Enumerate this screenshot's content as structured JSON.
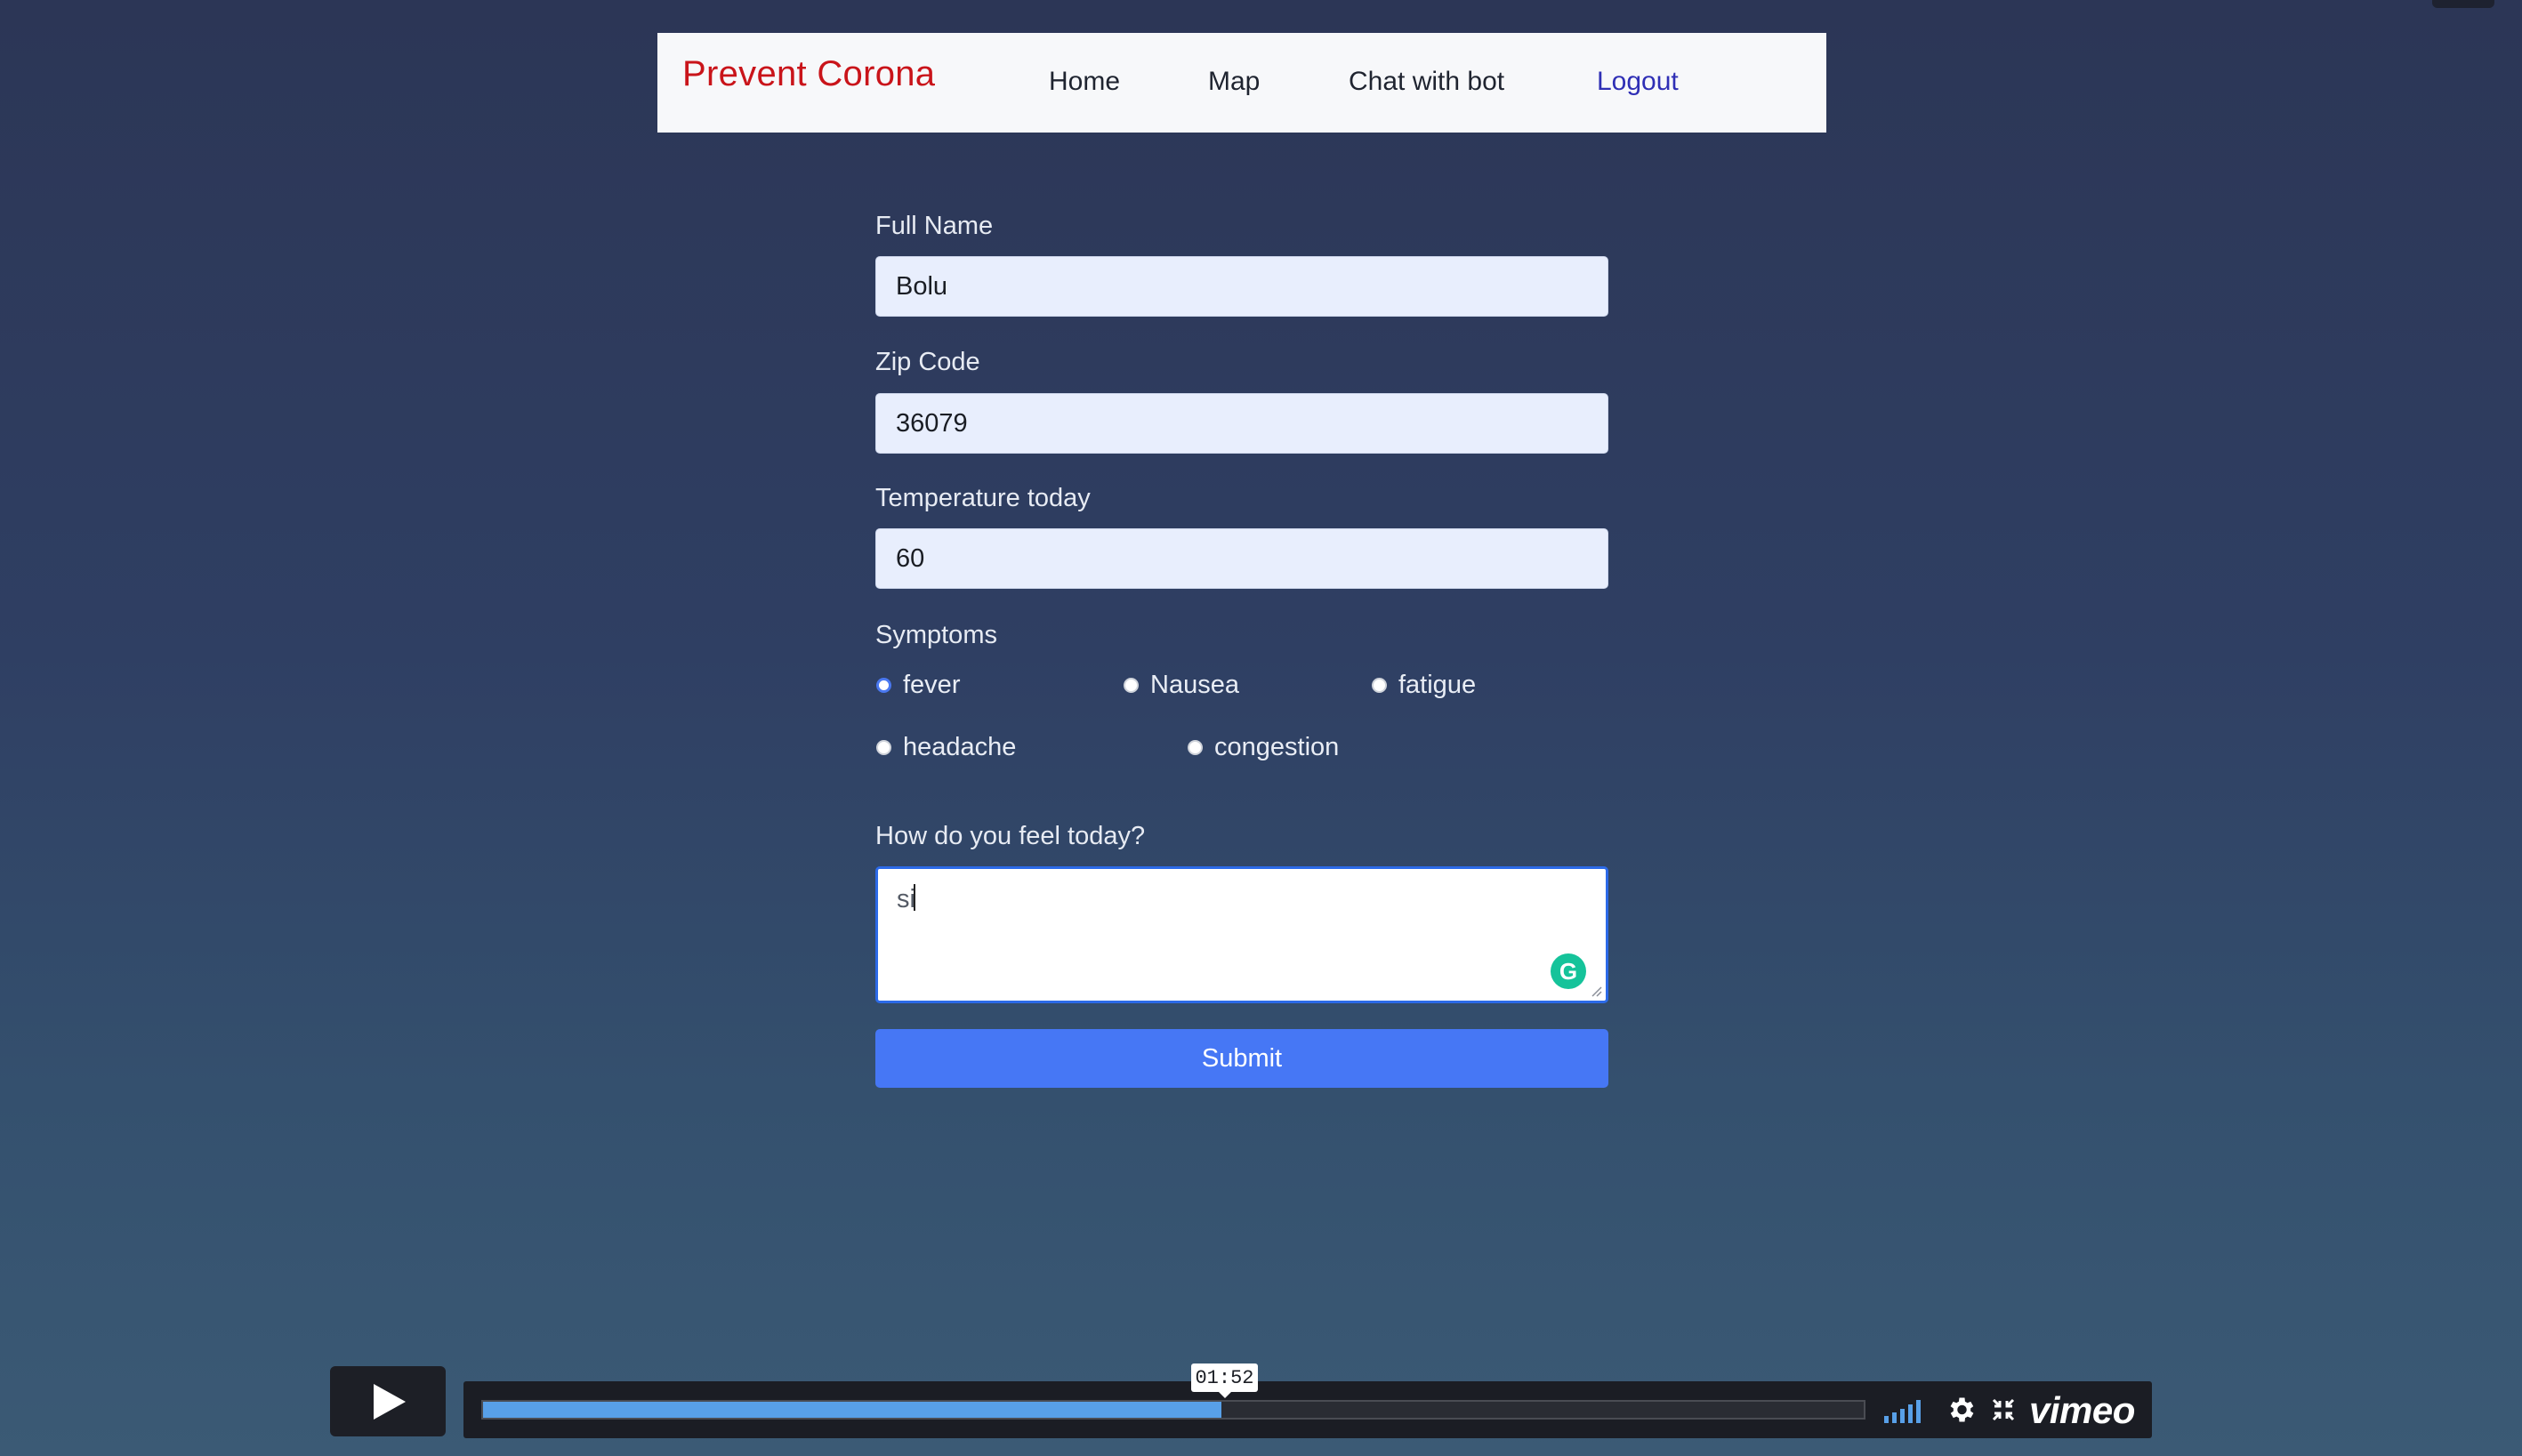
{
  "navbar": {
    "brand": "Prevent Corona",
    "items": [
      "Home",
      "Map",
      "Chat with bot",
      "Logout"
    ]
  },
  "form": {
    "full_name": {
      "label": "Full Name",
      "value": "Bolu"
    },
    "zip_code": {
      "label": "Zip Code",
      "value": "36079"
    },
    "temperature": {
      "label": "Temperature today",
      "value": "60"
    },
    "symptoms": {
      "label": "Symptoms",
      "options": [
        {
          "label": "fever",
          "checked": true
        },
        {
          "label": "Nausea",
          "checked": false
        },
        {
          "label": "fatigue",
          "checked": false
        },
        {
          "label": "headache",
          "checked": false
        },
        {
          "label": "congestion",
          "checked": false
        }
      ]
    },
    "feeling": {
      "label": "How do you feel today?",
      "value": "si"
    },
    "submit_label": "Submit"
  },
  "player": {
    "current_time": "01:52",
    "progress_fraction": 0.535,
    "brand": "vimeo",
    "colors": {
      "progress": "#58a0e8",
      "submit": "#4677f5",
      "brand_text": "#c9141a"
    }
  }
}
